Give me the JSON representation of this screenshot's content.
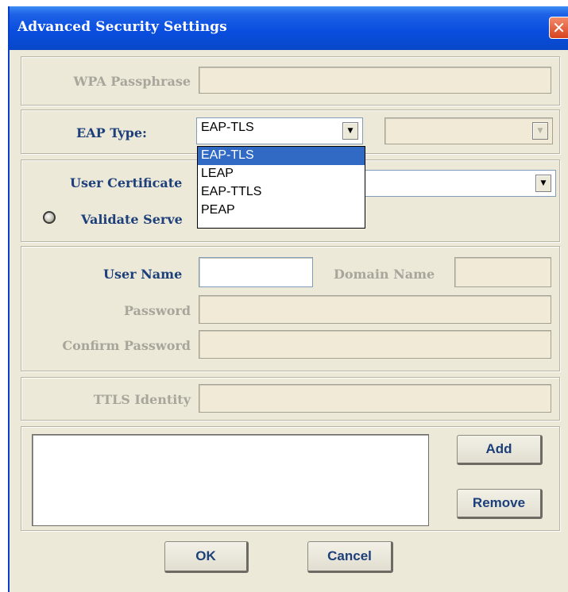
{
  "window": {
    "title": "Advanced Security Settings",
    "close_glyph": "✕"
  },
  "wpa": {
    "label": "WPA Passphrase",
    "value": ""
  },
  "eap": {
    "label": "EAP Type:",
    "selected": "EAP-TLS",
    "options": [
      "EAP-TLS",
      "LEAP",
      "EAP-TTLS",
      "PEAP"
    ],
    "secondary_value": ""
  },
  "cert": {
    "user_certificate_label": "User Certificate",
    "validate_label": "Validate Serve"
  },
  "credentials": {
    "user_name_label": "User Name",
    "domain_name_label": "Domain Name",
    "password_label": "Password",
    "confirm_password_label": "Confirm Password",
    "user_name": "",
    "domain_name": "",
    "password": "",
    "confirm_password": ""
  },
  "ttls": {
    "label": "TTLS Identity",
    "value": ""
  },
  "list": {
    "items": []
  },
  "buttons": {
    "add": "Add",
    "remove": "Remove",
    "ok": "OK",
    "cancel": "Cancel"
  },
  "colors": {
    "title_bar": "#0a4ee0",
    "dialog_bg": "#ece9d8",
    "label_enabled": "#1d3f7a",
    "label_disabled": "#a8a69a",
    "selection": "#316ac5"
  }
}
